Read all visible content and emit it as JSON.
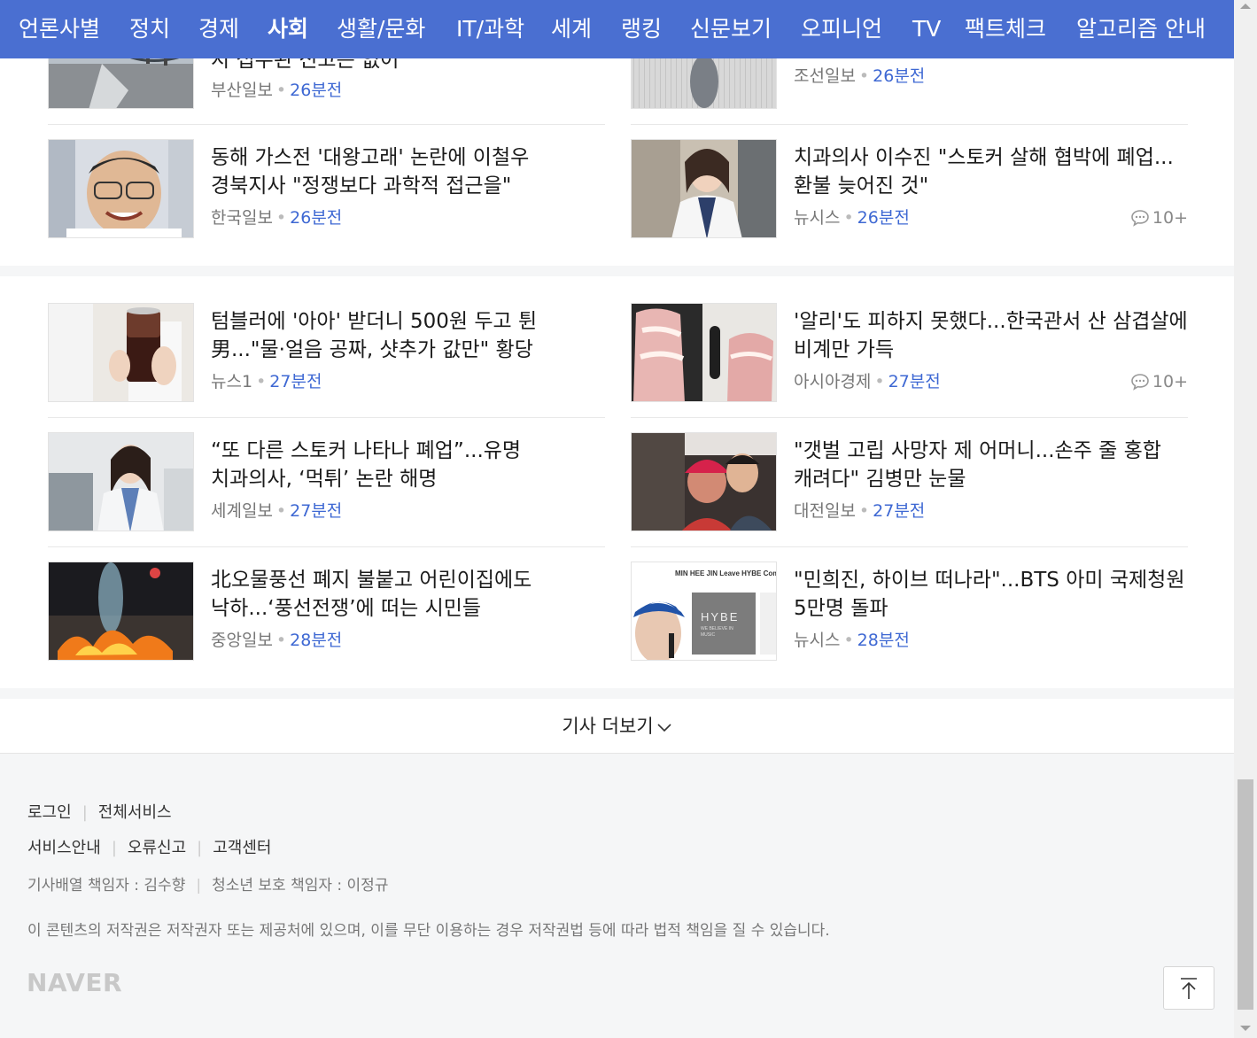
{
  "nav": {
    "items": [
      "언론사별",
      "정치",
      "경제",
      "사회",
      "생활/문화",
      "IT/과학",
      "세계",
      "랭킹",
      "신문보기",
      "오피니언",
      "TV",
      "팩트체크",
      "알고리즘 안내"
    ],
    "active": "사회"
  },
  "section1": {
    "articles": [
      {
        "headline": "지 접수된 신고는 없어",
        "press": "부산일보",
        "time": "26분전",
        "comments": ""
      },
      {
        "headline": "",
        "press": "조선일보",
        "time": "26분전",
        "comments": ""
      },
      {
        "headline": "동해 가스전 '대왕고래' 논란에 이철우 경북지사 \"정쟁보다 과학적 접근을\"",
        "press": "한국일보",
        "time": "26분전",
        "comments": ""
      },
      {
        "headline": "치과의사 이수진 \"스토커 살해 협박에 폐업...환불 늦어진 것\"",
        "press": "뉴시스",
        "time": "26분전",
        "comments": "10+"
      }
    ]
  },
  "section2": {
    "articles": [
      {
        "headline": "텀블러에 '아아' 받더니 500원 두고 튄 男...\"물·얼음 공짜, 샷추가 값만\" 황당",
        "press": "뉴스1",
        "time": "27분전",
        "comments": ""
      },
      {
        "headline": "'알리'도 피하지 못했다...한국관서 산 삼겹살에 비계만 가득",
        "press": "아시아경제",
        "time": "27분전",
        "comments": "10+"
      },
      {
        "headline": "“또 다른 스토커 나타나 폐업”...유명 치과의사, ‘먹튀’ 논란 해명",
        "press": "세계일보",
        "time": "27분전",
        "comments": ""
      },
      {
        "headline": "\"갯벌 고립 사망자 제 어머니...손주 줄 홍합 캐려다\" 김병만 눈물",
        "press": "대전일보",
        "time": "27분전",
        "comments": ""
      },
      {
        "headline": "北오물풍선 폐지 불붙고 어린이집에도 낙하...‘풍선전쟁’에 떠는 시민들",
        "press": "중앙일보",
        "time": "28분전",
        "comments": ""
      },
      {
        "headline": "\"민희진, 하이브 떠나라\"...BTS 아미 국제청원 5만명 돌파",
        "press": "뉴시스",
        "time": "28분전",
        "comments": ""
      }
    ]
  },
  "thumb_text": {
    "hybe_banner": "MIN HEE JIN Leave HYBE Comp",
    "hybe_logo": "HYBE",
    "hybe_sub": "WE BELIEVE IN MUSIC"
  },
  "more": {
    "label": "기사 더보기"
  },
  "footer": {
    "links_row1": [
      "로그인",
      "전체서비스"
    ],
    "links_row2": [
      "서비스안내",
      "오류신고",
      "고객센터"
    ],
    "editor": "기사배열 책임자 : 김수향",
    "youth": "청소년 보호 책임자 : 이정규",
    "copyright": "이 콘텐츠의 저작권은 저작권자 또는 제공처에 있으며, 이를 무단 이용하는 경우 저작권법 등에 따라 법적 책임을 질 수 있습니다.",
    "logo": "NAVER"
  },
  "colors": {
    "nav_bg": "#4a6fd1",
    "time": "#3e68d3",
    "bg": "#f5f6f7"
  }
}
